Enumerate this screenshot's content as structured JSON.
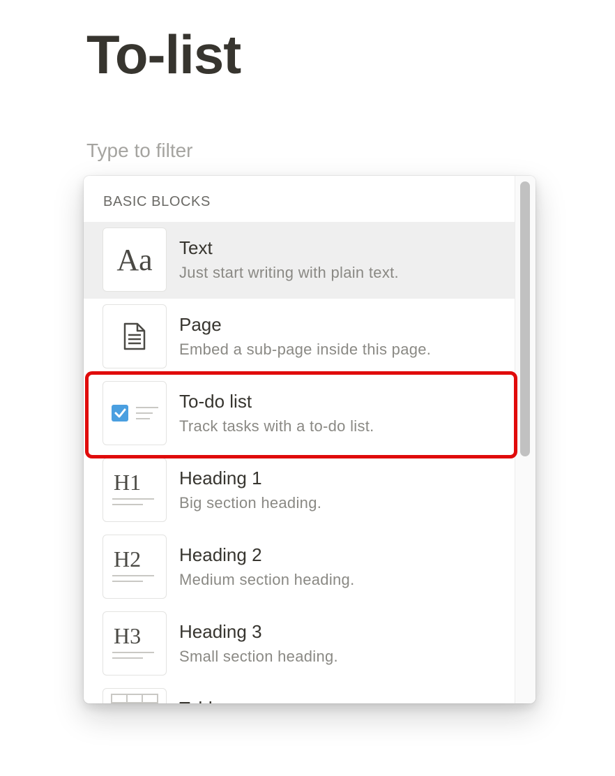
{
  "page": {
    "title": "To-list"
  },
  "filter": {
    "placeholder": "Type to filter"
  },
  "menu": {
    "section_label": "BASIC BLOCKS",
    "items": [
      {
        "title": "Text",
        "description": "Just start writing with plain text.",
        "icon": "text-aa-icon"
      },
      {
        "title": "Page",
        "description": "Embed a sub-page inside this page.",
        "icon": "page-document-icon"
      },
      {
        "title": "To-do list",
        "description": "Track tasks with a to-do list.",
        "icon": "todo-checkbox-icon"
      },
      {
        "title": "Heading 1",
        "description": "Big section heading.",
        "icon": "heading-1-icon",
        "glyph": "H1"
      },
      {
        "title": "Heading 2",
        "description": "Medium section heading.",
        "icon": "heading-2-icon",
        "glyph": "H2"
      },
      {
        "title": "Heading 3",
        "description": "Small section heading.",
        "icon": "heading-3-icon",
        "glyph": "H3"
      },
      {
        "title": "Table",
        "description": "",
        "icon": "table-icon"
      }
    ],
    "active_index": 0,
    "highlighted_index": 2
  },
  "icons": {
    "aa_glyph": "Aa"
  },
  "colors": {
    "title_text": "#37352f",
    "hover_background": "#efefef",
    "checkbox_blue": "#4a9fe0",
    "highlight_red": "#e00b0b"
  }
}
